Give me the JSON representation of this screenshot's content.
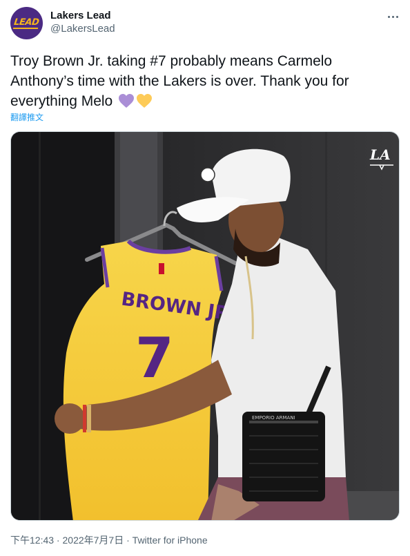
{
  "account": {
    "display_name": "Lakers Lead",
    "handle": "@LakersLead",
    "avatar_text": "LEAD"
  },
  "more_icon": "more-horizontal-icon",
  "tweet": {
    "text": "Troy Brown Jr. taking #7 probably means Carmelo Anthony’s time with the Lakers is over. Thank you for everything Melo",
    "emojis": [
      "purple-heart",
      "yellow-heart"
    ],
    "translate_label": "翻譯推文"
  },
  "media": {
    "watermark": "LA",
    "jersey_name": "BROWN JR.",
    "jersey_number": "7",
    "bag_brand": "EMPORIO ARMANI"
  },
  "meta": {
    "time": "下午12:43",
    "separator": " · ",
    "date": "2022年7月7日",
    "source": "Twitter for iPhone"
  },
  "colors": {
    "lakers_purple": "#552583",
    "lakers_gold": "#fdb927",
    "link_blue": "#1d9bf0",
    "secondary_text": "#536471"
  }
}
